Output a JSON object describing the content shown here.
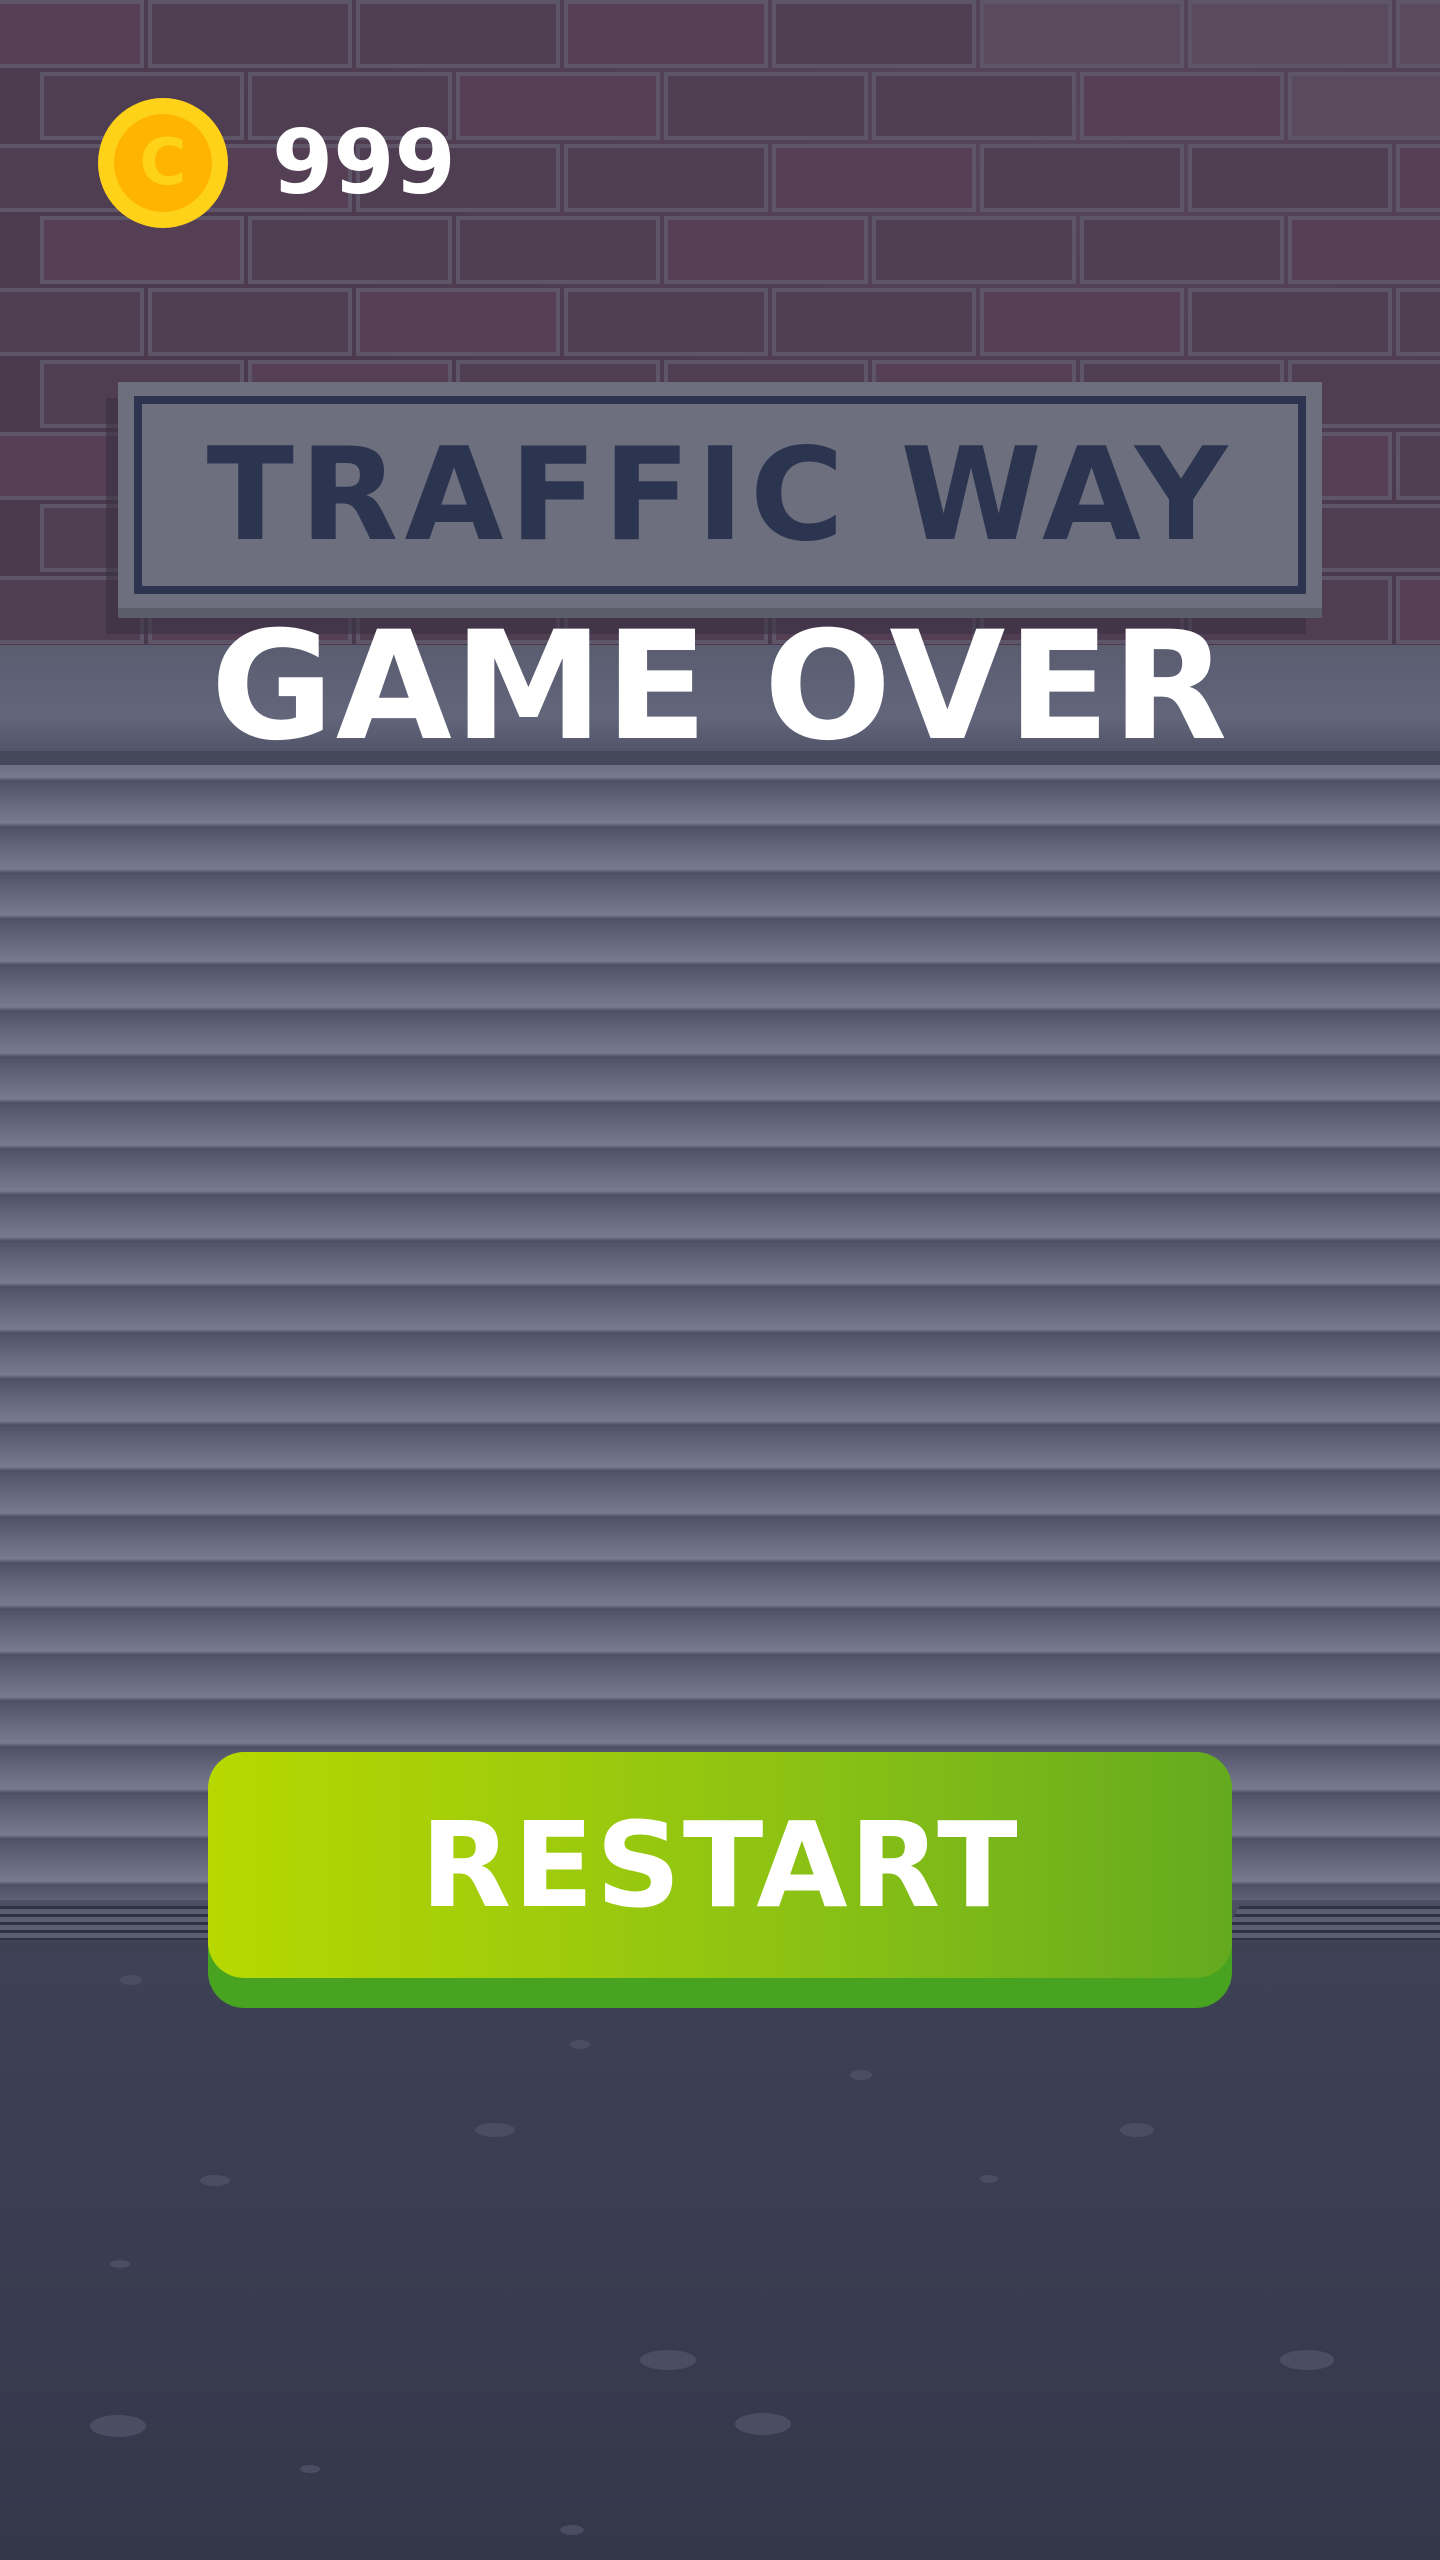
{
  "hud": {
    "coin_count": "999",
    "coin_icon": "coin-icon"
  },
  "sign": {
    "text": "TRAFFIC WAY"
  },
  "screen": {
    "title": "GAME OVER"
  },
  "actions": {
    "restart_label": "RESTART"
  },
  "colors": {
    "button_gradient_start": "#b7d800",
    "button_gradient_end": "#64aa1f",
    "sign_text": "#2b3550",
    "coin": "#ffd21a"
  }
}
